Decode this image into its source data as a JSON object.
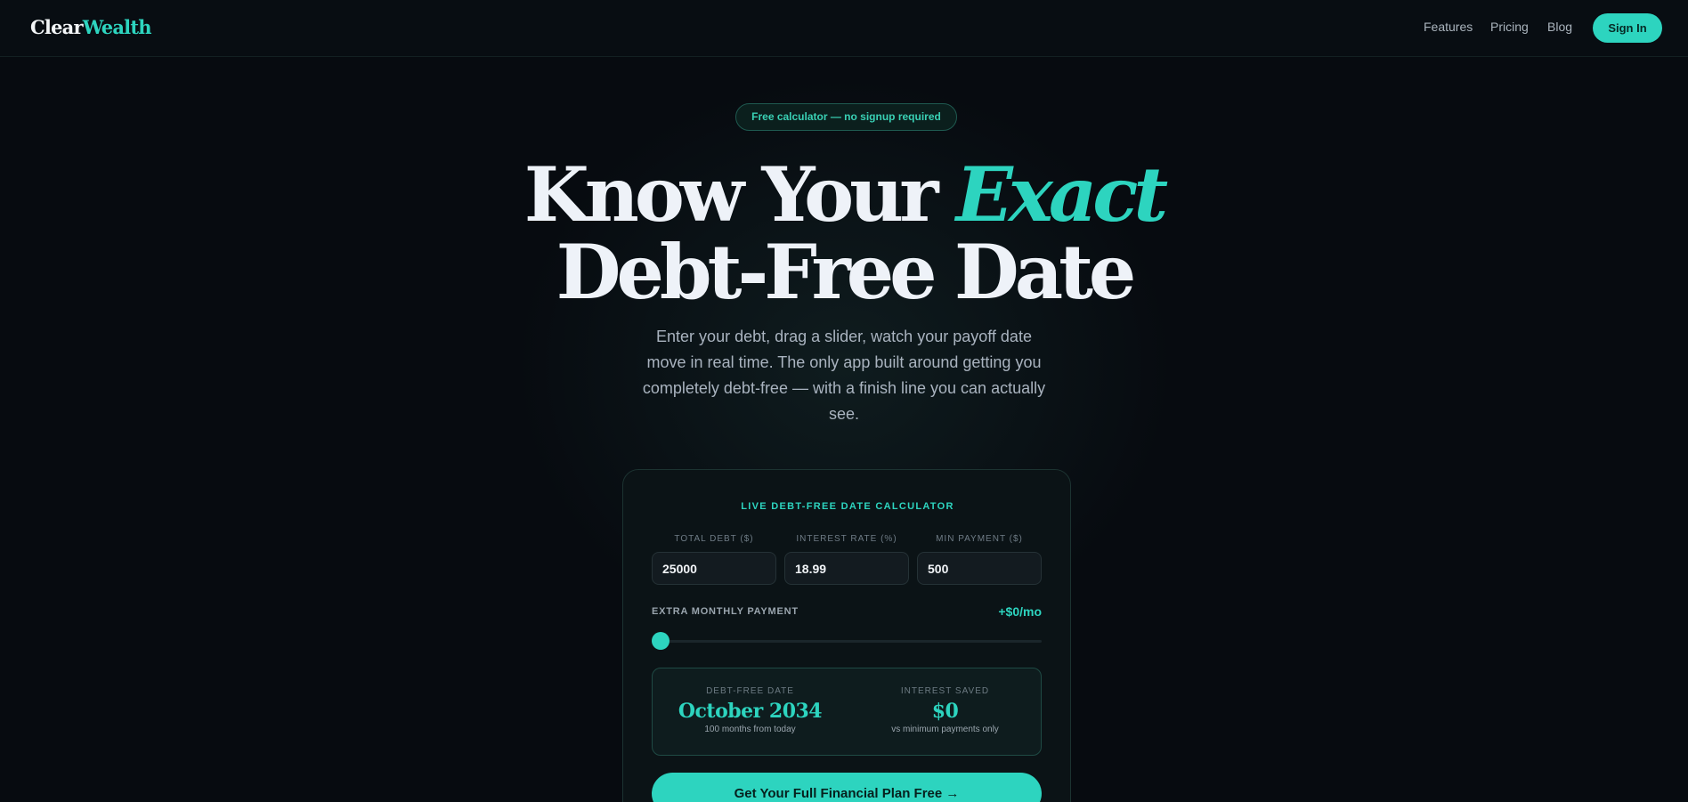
{
  "brand": {
    "logo_part1": "Clear",
    "logo_part2": "Wealth",
    "accent_color": "#2dd4bf"
  },
  "nav": {
    "links": [
      "Features",
      "Pricing",
      "Blog"
    ],
    "signin_label": "Sign In"
  },
  "hero": {
    "badge": "Free calculator — no signup required",
    "title_line1_a": "Know Your ",
    "title_line1_b": "Exact",
    "title_line2": "Debt-Free Date",
    "subtitle": "Enter your debt, drag a slider, watch your payoff date move in real time. The only app built around getting you completely debt-free — with a finish line you can actually see."
  },
  "calculator": {
    "title": "LIVE DEBT-FREE DATE CALCULATOR",
    "fields": [
      {
        "label": "TOTAL DEBT ($)",
        "value": "25000"
      },
      {
        "label": "INTEREST RATE (%)",
        "value": "18.99"
      },
      {
        "label": "MIN PAYMENT ($)",
        "value": "500"
      }
    ],
    "extra_label": "EXTRA MONTHLY PAYMENT",
    "extra_value": "+$0/mo",
    "slider_fraction": 0,
    "results": {
      "date_label": "DEBT-FREE DATE",
      "date_value": "October 2034",
      "date_note": "100 months from today",
      "saved_label": "INTEREST SAVED",
      "saved_value": "$0",
      "saved_note": "vs minimum payments only"
    },
    "cta_label": "Get Your Full Financial Plan Free →"
  }
}
